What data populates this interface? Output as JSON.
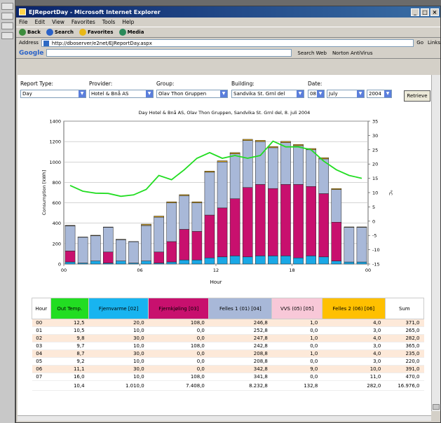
{
  "window": {
    "title": "EJReportDay - Microsoft Internet Explorer"
  },
  "menu": [
    "File",
    "Edit",
    "View",
    "Favorites",
    "Tools",
    "Help"
  ],
  "toolbar": {
    "back": "Back",
    "search": "Search",
    "favorites": "Favorites",
    "media": "Media"
  },
  "address": {
    "label": "Address",
    "url": "http://dboserver/e2net/EJReportDay.aspx",
    "go": "Go",
    "links": "Links"
  },
  "googlebar": {
    "logo": "Google",
    "search_web": "Search Web",
    "extra": "Norton AntiVirus"
  },
  "controls": {
    "report_type": {
      "label": "Report Type:",
      "value": "Day"
    },
    "provider": {
      "label": "Provider:",
      "value": "Hotel & Bnå AS"
    },
    "group": {
      "label": "Group:",
      "value": "Olav Thon Gruppen"
    },
    "building": {
      "label": "Building:",
      "value": "Sandvika St. Grnl del"
    },
    "date": {
      "label": "Date:",
      "day": "08",
      "month": "July",
      "year": "2004"
    },
    "retrieve": "Retrieve"
  },
  "chart_data": {
    "type": "bar",
    "title": "Day Hotel & Bnå AS, Olav Thon Gruppen, Sandvika St. Grnl del, 8. juli 2004",
    "xlabel": "Hour",
    "ylabel": "Consumption [kWh]",
    "y2label": "°C",
    "ylim": [
      0,
      1400
    ],
    "y2lim": [
      -15,
      35
    ],
    "yticks": [
      0,
      200,
      400,
      600,
      800,
      1000,
      1200,
      1400
    ],
    "y2ticks": [
      -15,
      -10,
      -5,
      0,
      5,
      10,
      15,
      20,
      25,
      30,
      35
    ],
    "xticks": [
      "00",
      "06",
      "12",
      "18",
      "00"
    ],
    "categories": [
      "00",
      "01",
      "02",
      "03",
      "04",
      "05",
      "06",
      "07",
      "08",
      "09",
      "10",
      "11",
      "12",
      "13",
      "14",
      "15",
      "16",
      "17",
      "18",
      "19",
      "20",
      "21",
      "22",
      "23"
    ],
    "series": [
      {
        "name": "Fjernvarme [02]",
        "color": "#1aa8e6",
        "values": [
          20,
          10,
          30,
          10,
          30,
          10,
          30,
          10,
          20,
          40,
          40,
          60,
          70,
          80,
          70,
          80,
          80,
          80,
          60,
          80,
          70,
          30,
          20,
          20
        ]
      },
      {
        "name": "Fjernkjøling [03]",
        "color": "#c8106e",
        "values": [
          108,
          0,
          0,
          108,
          0,
          0,
          0,
          108,
          200,
          300,
          280,
          420,
          480,
          560,
          680,
          700,
          660,
          700,
          720,
          680,
          620,
          380,
          0,
          0
        ]
      },
      {
        "name": "Felles 1 (01) [04]",
        "color": "#a8b8d8",
        "values": [
          246,
          252,
          247,
          242,
          208,
          208,
          342,
          341,
          380,
          330,
          280,
          420,
          450,
          440,
          460,
          420,
          400,
          410,
          380,
          360,
          340,
          320,
          340,
          340
        ]
      },
      {
        "name": "VVS (05) [05]",
        "color": "#ffffff",
        "values": [
          1,
          0,
          1,
          0,
          1,
          0,
          9,
          0,
          0,
          0,
          0,
          0,
          0,
          0,
          0,
          0,
          0,
          0,
          0,
          0,
          0,
          0,
          0,
          0
        ]
      },
      {
        "name": "Felles 2 (06) [06]",
        "color": "#d4a017",
        "values": [
          4,
          3,
          4,
          3,
          4,
          3,
          10,
          11,
          10,
          10,
          10,
          11,
          12,
          12,
          12,
          12,
          12,
          12,
          12,
          12,
          12,
          10,
          4,
          4
        ]
      }
    ],
    "line": {
      "name": "Out Temp.",
      "color": "#22dd22",
      "values": [
        12.5,
        10.5,
        9.8,
        9.7,
        8.7,
        9.2,
        11.1,
        16.0,
        14.5,
        18,
        22,
        24,
        22,
        23,
        22,
        23,
        28,
        26,
        26,
        25,
        21,
        18,
        16,
        15
      ]
    }
  },
  "table": {
    "headers": [
      {
        "label": "Hour",
        "color": "#ffffff"
      },
      {
        "label": "Out Temp.",
        "color": "#22dd22"
      },
      {
        "label": "Fjernvarme [02]",
        "color": "#18b4f0"
      },
      {
        "label": "Fjernkjøling [03]",
        "color": "#c8106e"
      },
      {
        "label": "Felles 1 (01) [04]",
        "color": "#a8b8d8"
      },
      {
        "label": "VVS (05) [05]",
        "color": "#f8c8d8"
      },
      {
        "label": "Felles 2 (06) [06]",
        "color": "#ffc000"
      },
      {
        "label": "Sum",
        "color": "#ffffff"
      }
    ],
    "rows": [
      [
        "00",
        "12,5",
        "20,0",
        "108,0",
        "246,8",
        "1,0",
        "4,0",
        "371,0"
      ],
      [
        "01",
        "10,5",
        "10,0",
        "0,0",
        "252,8",
        "0,0",
        "3,0",
        "265,0"
      ],
      [
        "02",
        "9,8",
        "30,0",
        "0,0",
        "247,8",
        "1,0",
        "4,0",
        "282,0"
      ],
      [
        "03",
        "9,7",
        "10,0",
        "108,0",
        "242,8",
        "0,0",
        "3,0",
        "365,0"
      ],
      [
        "04",
        "8,7",
        "30,0",
        "0,0",
        "208,8",
        "1,0",
        "4,0",
        "235,0"
      ],
      [
        "05",
        "9,2",
        "10,0",
        "0,0",
        "208,8",
        "0,0",
        "3,0",
        "220,0"
      ],
      [
        "06",
        "11,1",
        "30,0",
        "0,0",
        "342,8",
        "9,0",
        "10,0",
        "391,0"
      ],
      [
        "07",
        "16,0",
        "10,0",
        "108,0",
        "341,8",
        "0,0",
        "11,0",
        "470,0"
      ]
    ],
    "sum": [
      "",
      "10,4",
      "1.010,0",
      "7.408,0",
      "8.232,8",
      "132,8",
      "282,0",
      "16.976,0"
    ]
  }
}
